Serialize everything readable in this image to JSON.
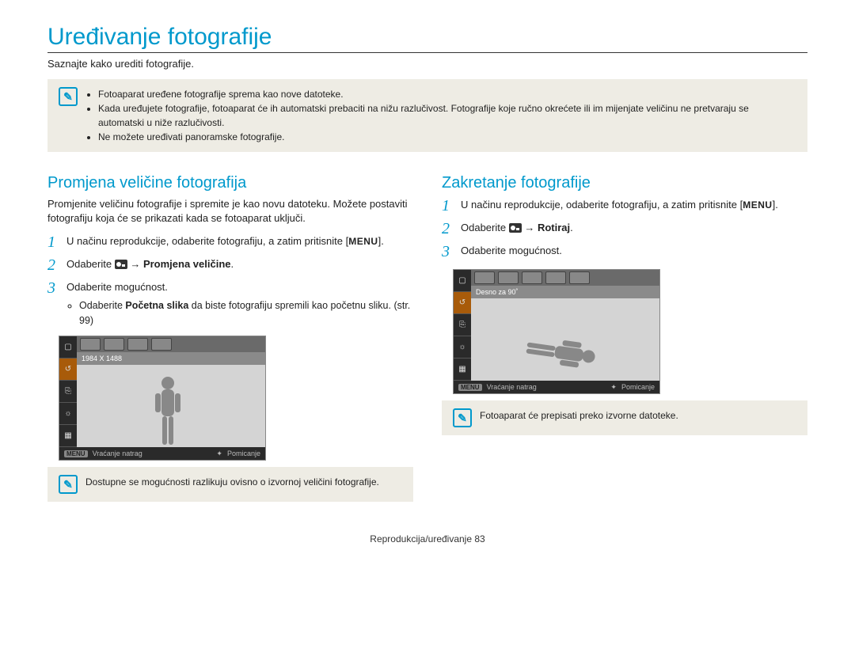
{
  "title": "Uređivanje fotografije",
  "intro": "Saznajte kako urediti fotografije.",
  "top_note": {
    "items": [
      "Fotoaparat uređene fotografije sprema kao nove datoteke.",
      "Kada uređujete fotografije, fotoaparat će ih automatski prebaciti na nižu razlučivost. Fotografije koje ručno okrećete ili im mijenjate veličinu ne pretvaraju se automatski u niže razlučivosti.",
      "Ne možete uređivati panoramske fotografije."
    ]
  },
  "left": {
    "heading": "Promjena veličine fotografija",
    "para": "Promjenite veličinu fotografije i spremite je kao novu datoteku. Možete postaviti fotografiju koja će se prikazati kada se fotoaparat uključi.",
    "step1": "U načinu reprodukcije, odaberite fotografiju, a zatim pritisnite [",
    "step1_after": "].",
    "step2_pre": "Odaberite ",
    "step2_bold": " → Promjena veličine",
    "step3": "Odaberite mogućnost.",
    "bullet_pre": "Odaberite ",
    "bullet_bold": "Početna slika",
    "bullet_post": " da biste fotografiju spremili kao početnu sliku. (str. 99)",
    "preview_label": "1984 X 1488",
    "bottom_back": "Vraćanje natrag",
    "bottom_move": "Pomicanje",
    "note": "Dostupne se mogućnosti razlikuju ovisno o izvornoj veličini fotografije."
  },
  "right": {
    "heading": "Zakretanje fotografije",
    "step1": "U načinu reprodukcije, odaberite fotografiju, a zatim pritisnite [",
    "step1_after": "].",
    "step2_pre": "Odaberite ",
    "step2_bold": " → Rotiraj",
    "step3": "Odaberite mogućnost.",
    "preview_label": "Desno za 90˚",
    "bottom_back": "Vraćanje natrag",
    "bottom_move": "Pomicanje",
    "note": "Fotoaparat će prepisati preko izvorne datoteke."
  },
  "menu_key": "MENU",
  "footer": "Reprodukcija/uređivanje  83"
}
